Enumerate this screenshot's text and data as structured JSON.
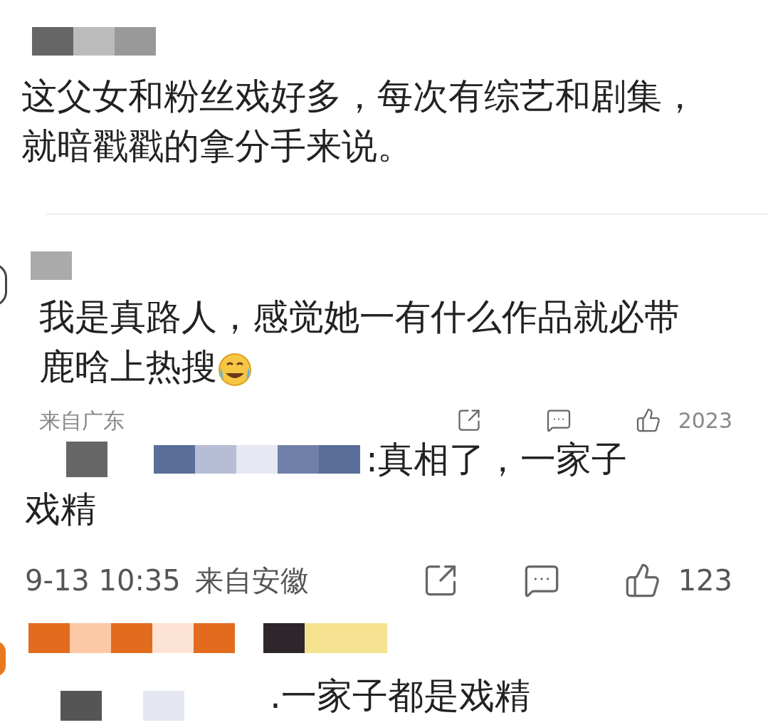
{
  "comments": [
    {
      "text": "这父女和粉丝戏好多，每次有综艺和剧集，就暗戳戳的拿分手来说。"
    },
    {
      "text": "我是真路人，感觉她一有什么作品就必带鹿晗上热搜",
      "emoji": true,
      "meta": {
        "location": "来自广东",
        "likes": "2023"
      }
    },
    {
      "text": ":真相了，一家子",
      "text_continued": "戏精",
      "meta": {
        "time": "9-13 10:35",
        "location": "来自安徽",
        "likes": "123"
      }
    },
    {
      "text": ".一家子都是戏精"
    }
  ]
}
